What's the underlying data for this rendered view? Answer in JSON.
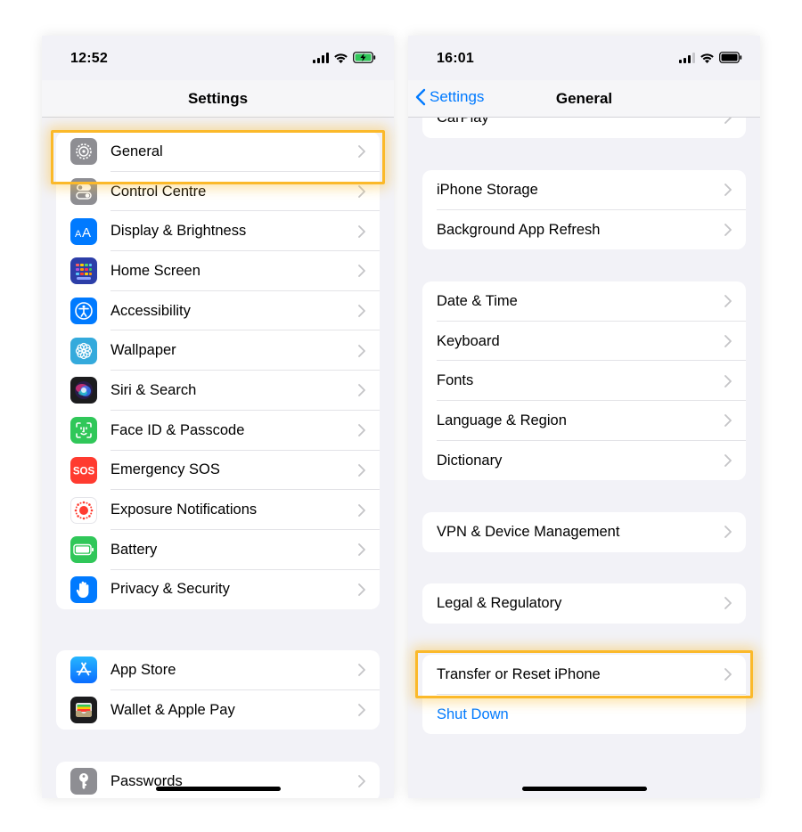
{
  "left_phone": {
    "time": "12:52",
    "title": "Settings",
    "groups": [
      {
        "items": [
          {
            "label": "General",
            "icon": "gear-icon",
            "color": "#8e8e93"
          },
          {
            "label": "Control Centre",
            "icon": "toggles-icon",
            "color": "#8e8e93"
          },
          {
            "label": "Display & Brightness",
            "icon": "text-size-icon",
            "color": "#007aff"
          },
          {
            "label": "Home Screen",
            "icon": "app-grid-icon",
            "color": "#2c3ea8"
          },
          {
            "label": "Accessibility",
            "icon": "accessibility-icon",
            "color": "#007aff"
          },
          {
            "label": "Wallpaper",
            "icon": "flower-icon",
            "color": "#34aadc"
          },
          {
            "label": "Siri & Search",
            "icon": "siri-icon",
            "color": "#1c1c1e"
          },
          {
            "label": "Face ID & Passcode",
            "icon": "face-id-icon",
            "color": "#30c759"
          },
          {
            "label": "Emergency SOS",
            "icon": "sos-icon",
            "color": "#ff3b30"
          },
          {
            "label": "Exposure Notifications",
            "icon": "exposure-icon",
            "color": "#ffffff"
          },
          {
            "label": "Battery",
            "icon": "battery-icon",
            "color": "#30c759"
          },
          {
            "label": "Privacy & Security",
            "icon": "hand-icon",
            "color": "#007aff"
          }
        ]
      },
      {
        "items": [
          {
            "label": "App Store",
            "icon": "app-store-icon",
            "color": "#1a8cff"
          },
          {
            "label": "Wallet & Apple Pay",
            "icon": "wallet-icon",
            "color": "#1c1c1e"
          }
        ]
      },
      {
        "items": [
          {
            "label": "Passwords",
            "icon": "key-icon",
            "color": "#8e8e93"
          }
        ]
      }
    ]
  },
  "right_phone": {
    "time": "16:01",
    "back_label": "Settings",
    "title": "General",
    "groups": [
      {
        "items": [
          {
            "label": "CarPlay"
          }
        ]
      },
      {
        "items": [
          {
            "label": "iPhone Storage"
          },
          {
            "label": "Background App Refresh"
          }
        ]
      },
      {
        "items": [
          {
            "label": "Date & Time"
          },
          {
            "label": "Keyboard"
          },
          {
            "label": "Fonts"
          },
          {
            "label": "Language & Region"
          },
          {
            "label": "Dictionary"
          }
        ]
      },
      {
        "items": [
          {
            "label": "VPN & Device Management"
          }
        ]
      },
      {
        "items": [
          {
            "label": "Legal & Regulatory"
          }
        ]
      },
      {
        "items": [
          {
            "label": "Transfer or Reset iPhone"
          },
          {
            "label": "Shut Down",
            "style": "link"
          }
        ]
      }
    ]
  },
  "colors": {
    "highlight": "#fbb92a",
    "accent": "#007aff",
    "background": "#f2f2f7"
  }
}
